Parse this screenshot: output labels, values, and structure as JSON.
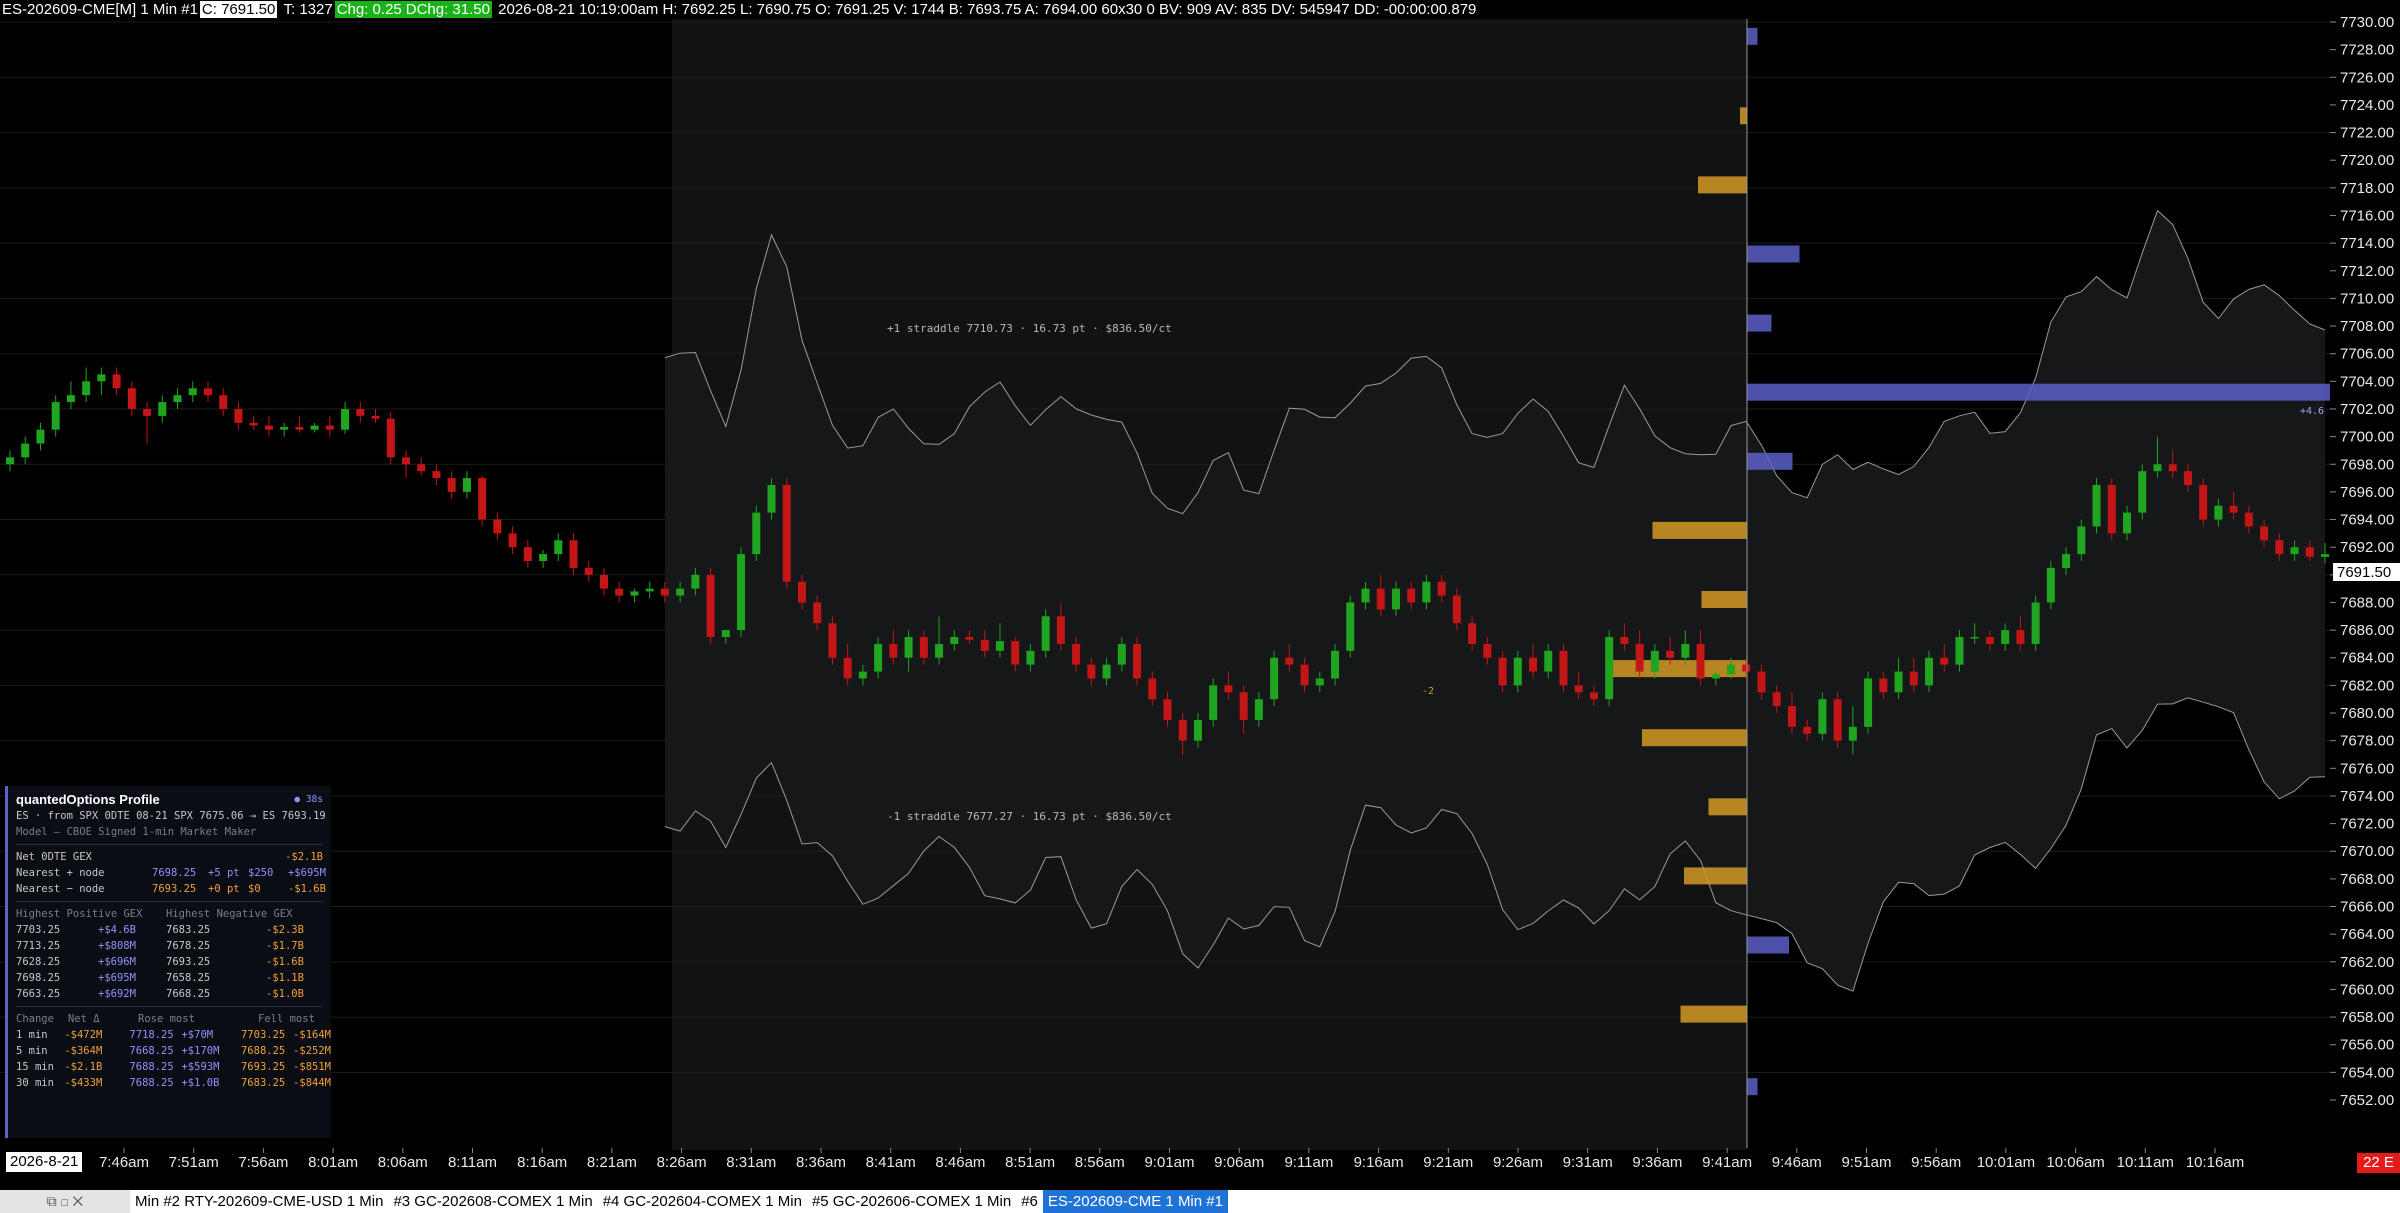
{
  "top_bar": {
    "symbol": "ES-202609-CME[M]  1 Min  #1",
    "close": "C: 7691.50",
    "ticks": "T: 1327",
    "change": "Chg: 0.25",
    "daily_change": "DChg: 31.50",
    "details": "2026-08-21 10:19:00am  H: 7692.25  L: 7690.75  O: 7691.25  V: 1744  B: 7693.75  A: 7694.00  60x30  0  BV: 909  AV: 835  DV: 545947  DD: -00:00:00.879"
  },
  "colors": {
    "up_candle": "#1fa51f",
    "down_candle": "#c41616",
    "positive_gex": "#5b5fc7",
    "negative_gex": "#d39a25",
    "background": "#000000",
    "last_price_box": "#ffffff"
  },
  "price_axis": {
    "labels": [
      "7730.00",
      "7728.00",
      "7726.00",
      "7724.00",
      "7722.00",
      "7720.00",
      "7718.00",
      "7716.00",
      "7714.00",
      "7712.00",
      "7710.00",
      "7708.00",
      "7706.00",
      "7704.00",
      "7702.00",
      "7700.00",
      "7698.00",
      "7696.00",
      "7694.00",
      "7692.00",
      "7690.00",
      "7688.00",
      "7686.00",
      "7684.00",
      "7682.00",
      "7680.00",
      "7678.00",
      "7676.00",
      "7674.00",
      "7672.00",
      "7670.00",
      "7668.00",
      "7666.00",
      "7664.00",
      "7662.00",
      "7660.00",
      "7658.00",
      "7656.00",
      "7654.00",
      "7652.00"
    ],
    "last_price": "7691.50"
  },
  "time_axis": {
    "date": "2026-8-21",
    "labels": [
      "7:46am",
      "7:51am",
      "7:56am",
      "8:01am",
      "8:06am",
      "8:11am",
      "8:16am",
      "8:21am",
      "8:26am",
      "8:31am",
      "8:36am",
      "8:41am",
      "8:46am",
      "8:51am",
      "8:56am",
      "9:01am",
      "9:06am",
      "9:11am",
      "9:16am",
      "9:21am",
      "9:26am",
      "9:31am",
      "9:36am",
      "9:41am",
      "9:46am",
      "9:51am",
      "9:56am",
      "10:01am",
      "10:06am",
      "10:11am",
      "10:16am"
    ]
  },
  "bars_on_chart": "22 E",
  "annotations": {
    "upper_straddle": "+1 straddle 7710.73 · 16.73 pt · $836.50/ct",
    "lower_straddle": "-1 straddle 7677.27 · 16.73 pt · $836.50/ct",
    "gex_marker": "-2",
    "right_marker": "+4.6"
  },
  "chart_data": {
    "type": "candlestick",
    "ylim": [
      7651,
      7731
    ],
    "interval": "1 Min",
    "gex_levels": [
      {
        "price": 7729.0,
        "gex_billion": 0.3,
        "sign": "positive"
      },
      {
        "price": 7723.25,
        "gex_billion": 0.2,
        "sign": "negative"
      },
      {
        "price": 7718.25,
        "gex_billion": 1.4,
        "sign": "negative"
      },
      {
        "price": 7713.25,
        "gex_billion": 1.5,
        "sign": "positive"
      },
      {
        "price": 7708.25,
        "gex_billion": 0.7,
        "sign": "positive"
      },
      {
        "price": 7703.25,
        "gex_billion": 4.6,
        "sign": "positive"
      },
      {
        "price": 7698.25,
        "gex_billion": 1.3,
        "sign": "positive"
      },
      {
        "price": 7693.25,
        "gex_billion": 2.7,
        "sign": "negative"
      },
      {
        "price": 7688.25,
        "gex_billion": 1.3,
        "sign": "negative"
      },
      {
        "price": 7683.25,
        "gex_billion": 4.0,
        "sign": "negative"
      },
      {
        "price": 7678.25,
        "gex_billion": 3.0,
        "sign": "negative"
      },
      {
        "price": 7673.25,
        "gex_billion": 1.1,
        "sign": "negative"
      },
      {
        "price": 7668.25,
        "gex_billion": 1.8,
        "sign": "negative"
      },
      {
        "price": 7663.25,
        "gex_billion": 1.2,
        "sign": "positive"
      },
      {
        "price": 7658.25,
        "gex_billion": 1.9,
        "sign": "negative"
      },
      {
        "price": 7653.0,
        "gex_billion": 0.3,
        "sign": "positive"
      }
    ],
    "candles": [
      [
        7698,
        7699,
        7697.5,
        7698.5
      ],
      [
        7698.5,
        7700,
        7698,
        7699.5
      ],
      [
        7699.5,
        7701,
        7699,
        7700.5
      ],
      [
        7700.5,
        7703,
        7700,
        7702.5
      ],
      [
        7702.5,
        7704,
        7702,
        7703
      ],
      [
        7703,
        7705,
        7702.5,
        7704
      ],
      [
        7704,
        7705,
        7703,
        7704.5
      ],
      [
        7704.5,
        7705,
        7703,
        7703.5
      ],
      [
        7703.5,
        7704,
        7701.5,
        7702
      ],
      [
        7702,
        7702.5,
        7699.5,
        7701.5
      ],
      [
        7701.5,
        7703,
        7701,
        7702.5
      ],
      [
        7702.5,
        7703.5,
        7702,
        7703
      ],
      [
        7703,
        7704,
        7702.5,
        7703.5
      ],
      [
        7703.5,
        7704,
        7702.5,
        7703
      ],
      [
        7703,
        7703.5,
        7701.5,
        7702
      ],
      [
        7702,
        7702.5,
        7700.5,
        7701
      ],
      [
        7701,
        7701.5,
        7700.5,
        7700.8
      ],
      [
        7700.8,
        7701.5,
        7700,
        7700.5
      ],
      [
        7700.5,
        7701,
        7700,
        7700.7
      ],
      [
        7700.7,
        7701.5,
        7700.3,
        7700.5
      ],
      [
        7700.5,
        7701,
        7700.3,
        7700.8
      ],
      [
        7700.8,
        7701.5,
        7700,
        7700.5
      ],
      [
        7700.5,
        7702.5,
        7700.2,
        7702
      ],
      [
        7702,
        7702.5,
        7701,
        7701.5
      ],
      [
        7701.5,
        7702,
        7701,
        7701.3
      ],
      [
        7701.3,
        7701.8,
        7698,
        7698.5
      ],
      [
        7698.5,
        7699,
        7697,
        7698
      ],
      [
        7698,
        7698.5,
        7697.2,
        7697.5
      ],
      [
        7697.5,
        7698,
        7696.5,
        7697
      ],
      [
        7697,
        7697.5,
        7695.5,
        7696
      ],
      [
        7696,
        7697.5,
        7695.5,
        7697
      ],
      [
        7697,
        7697.2,
        7693.5,
        7694
      ],
      [
        7694,
        7694.5,
        7692.5,
        7693
      ],
      [
        7693,
        7693.5,
        7691.5,
        7692
      ],
      [
        7692,
        7692.5,
        7690.5,
        7691
      ],
      [
        7691,
        7691.8,
        7690.5,
        7691.5
      ],
      [
        7691.5,
        7693,
        7691,
        7692.5
      ],
      [
        7692.5,
        7693,
        7690,
        7690.5
      ],
      [
        7690.5,
        7691,
        7689.5,
        7690
      ],
      [
        7690,
        7690.5,
        7688.5,
        7689
      ],
      [
        7689,
        7689.5,
        7688,
        7688.5
      ],
      [
        7688.5,
        7689,
        7688,
        7688.8
      ],
      [
        7688.8,
        7689.5,
        7688.3,
        7689
      ],
      [
        7689,
        7689.5,
        7688,
        7688.5
      ],
      [
        7688.5,
        7689.5,
        7688,
        7689
      ],
      [
        7689,
        7690.5,
        7688.5,
        7690
      ],
      [
        7690,
        7690.5,
        7685,
        7685.5
      ],
      [
        7685.5,
        7686,
        7685,
        7686
      ],
      [
        7686,
        7692,
        7685.5,
        7691.5
      ],
      [
        7691.5,
        7695,
        7691,
        7694.5
      ],
      [
        7694.5,
        7697,
        7694,
        7696.5
      ],
      [
        7696.5,
        7697,
        7689,
        7689.5
      ],
      [
        7689.5,
        7690,
        7687.5,
        7688
      ],
      [
        7688,
        7688.5,
        7686,
        7686.5
      ],
      [
        7686.5,
        7687,
        7683.5,
        7684
      ],
      [
        7684,
        7685,
        7682,
        7682.5
      ],
      [
        7682.5,
        7683.5,
        7682,
        7683
      ],
      [
        7683,
        7685.5,
        7682.5,
        7685
      ],
      [
        7685,
        7686,
        7683.5,
        7684
      ],
      [
        7684,
        7686,
        7683,
        7685.5
      ],
      [
        7685.5,
        7686,
        7683.5,
        7684
      ],
      [
        7684,
        7687,
        7683.5,
        7685
      ],
      [
        7685,
        7686,
        7684.5,
        7685.5
      ],
      [
        7685.5,
        7686,
        7685,
        7685.3
      ],
      [
        7685.3,
        7686,
        7684,
        7684.5
      ],
      [
        7684.5,
        7686.5,
        7684,
        7685.2
      ],
      [
        7685.2,
        7685.5,
        7683,
        7683.5
      ],
      [
        7683.5,
        7685,
        7683,
        7684.5
      ],
      [
        7684.5,
        7687.5,
        7684,
        7687
      ],
      [
        7687,
        7688,
        7684.5,
        7685
      ],
      [
        7685,
        7685.5,
        7683,
        7683.5
      ],
      [
        7683.5,
        7684,
        7682,
        7682.5
      ],
      [
        7682.5,
        7684,
        7682,
        7683.5
      ],
      [
        7683.5,
        7685.5,
        7683,
        7685
      ],
      [
        7685,
        7685.5,
        7682,
        7682.5
      ],
      [
        7682.5,
        7683,
        7680.5,
        7681
      ],
      [
        7681,
        7681.5,
        7679,
        7679.5
      ],
      [
        7679.5,
        7680,
        7677,
        7678
      ],
      [
        7678,
        7680,
        7677.5,
        7679.5
      ],
      [
        7679.5,
        7682.5,
        7679,
        7682
      ],
      [
        7682,
        7683,
        7681,
        7681.5
      ],
      [
        7681.5,
        7682,
        7678.5,
        7679.5
      ],
      [
        7679.5,
        7681.5,
        7679,
        7681
      ],
      [
        7681,
        7684.5,
        7680.5,
        7684
      ],
      [
        7684,
        7685,
        7683,
        7683.5
      ],
      [
        7683.5,
        7684,
        7681.5,
        7682
      ],
      [
        7682,
        7683,
        7681.5,
        7682.5
      ],
      [
        7682.5,
        7685,
        7682,
        7684.5
      ],
      [
        7684.5,
        7688.5,
        7684,
        7688
      ],
      [
        7688,
        7689.5,
        7687.5,
        7689
      ],
      [
        7689,
        7690,
        7687,
        7687.5
      ],
      [
        7687.5,
        7689.5,
        7687,
        7689
      ],
      [
        7689,
        7689.5,
        7687.5,
        7688
      ],
      [
        7688,
        7690,
        7687.5,
        7689.5
      ],
      [
        7689.5,
        7690,
        7688,
        7688.5
      ],
      [
        7688.5,
        7689,
        7686,
        7686.5
      ],
      [
        7686.5,
        7687,
        7684.5,
        7685
      ],
      [
        7685,
        7685.5,
        7683.5,
        7684
      ],
      [
        7684,
        7684.5,
        7681.5,
        7682
      ],
      [
        7682,
        7684.5,
        7681.5,
        7684
      ],
      [
        7684,
        7685,
        7682.5,
        7683
      ],
      [
        7683,
        7685,
        7682.5,
        7684.5
      ],
      [
        7684.5,
        7685,
        7681.5,
        7682
      ],
      [
        7682,
        7683,
        7681,
        7681.5
      ],
      [
        7681.5,
        7682,
        7680.5,
        7681
      ],
      [
        7681,
        7686,
        7680.5,
        7685.5
      ],
      [
        7685.5,
        7686.5,
        7684.5,
        7685
      ],
      [
        7685,
        7686,
        7682.5,
        7683
      ],
      [
        7683,
        7685,
        7682.5,
        7684.5
      ],
      [
        7684.5,
        7685.5,
        7683.5,
        7684
      ],
      [
        7684,
        7686,
        7683.5,
        7685
      ],
      [
        7685,
        7686,
        7682,
        7682.5
      ],
      [
        7682.5,
        7683,
        7682,
        7682.8
      ],
      [
        7682.8,
        7684,
        7682.5,
        7683.5
      ],
      [
        7683.5,
        7684,
        7682.5,
        7683
      ],
      [
        7683,
        7683.5,
        7681,
        7681.5
      ],
      [
        7681.5,
        7682,
        7680,
        7680.5
      ],
      [
        7680.5,
        7681.5,
        7678.5,
        7679
      ],
      [
        7679,
        7679.5,
        7678,
        7678.5
      ],
      [
        7678.5,
        7681.5,
        7678,
        7681
      ],
      [
        7681,
        7681.5,
        7677.5,
        7678
      ],
      [
        7678,
        7680.5,
        7677,
        7679
      ],
      [
        7679,
        7683,
        7678.5,
        7682.5
      ],
      [
        7682.5,
        7683,
        7681,
        7681.5
      ],
      [
        7681.5,
        7684,
        7681,
        7683
      ],
      [
        7683,
        7684,
        7681.5,
        7682
      ],
      [
        7682,
        7684.5,
        7681.5,
        7684
      ],
      [
        7684,
        7685,
        7683,
        7683.5
      ],
      [
        7683.5,
        7686,
        7683,
        7685.5
      ],
      [
        7685.5,
        7686.5,
        7685,
        7685.5
      ],
      [
        7685.5,
        7686,
        7684.5,
        7685
      ],
      [
        7685,
        7686.5,
        7684.5,
        7686
      ],
      [
        7686,
        7687,
        7684.5,
        7685
      ],
      [
        7685,
        7688.5,
        7684.5,
        7688
      ],
      [
        7688,
        7691,
        7687.5,
        7690.5
      ],
      [
        7690.5,
        7692,
        7690,
        7691.5
      ],
      [
        7691.5,
        7694,
        7691,
        7693.5
      ],
      [
        7693.5,
        7697,
        7693,
        7696.5
      ],
      [
        7696.5,
        7697,
        7692.5,
        7693
      ],
      [
        7693,
        7695,
        7692.5,
        7694.5
      ],
      [
        7694.5,
        7698,
        7694,
        7697.5
      ],
      [
        7697.5,
        7700,
        7697,
        7698
      ],
      [
        7698,
        7699,
        7697,
        7697.5
      ],
      [
        7697.5,
        7698,
        7696,
        7696.5
      ],
      [
        7696.5,
        7697,
        7693.5,
        7694
      ],
      [
        7694,
        7695.5,
        7693.5,
        7695
      ],
      [
        7695,
        7696,
        7694,
        7694.5
      ],
      [
        7694.5,
        7695,
        7693,
        7693.5
      ],
      [
        7693.5,
        7694,
        7692,
        7692.5
      ],
      [
        7692.5,
        7693,
        7691,
        7691.5
      ],
      [
        7691.5,
        7692.5,
        7691,
        7692
      ],
      [
        7692,
        7692.5,
        7691,
        7691.3
      ],
      [
        7691.3,
        7692.3,
        7690.8,
        7691.5
      ]
    ]
  },
  "gex_panel": {
    "title": "quantedOptions Profile",
    "age": "● 38s",
    "source": "ES · from SPX 0DTE 08-21  SPX 7675.06 → ES 7693.19",
    "model": "Model — CBOE Signed 1-min Market Maker",
    "net_label": "Net 0DTE GEX",
    "net_value": "-$2.1B",
    "nearest_pos": {
      "label": "Nearest + node",
      "price": "7698.25",
      "dist": "+5 pt",
      "cost": "$250",
      "gex": "+$695M"
    },
    "nearest_neg": {
      "label": "Nearest − node",
      "price": "7693.25",
      "dist": "+0 pt",
      "cost": "$0",
      "gex": "-$1.6B"
    },
    "highest_pos_header": "Highest Positive GEX",
    "highest_neg_header": "Highest Negative GEX",
    "highest_rows": [
      {
        "pos_price": "7703.25",
        "pos_val": "+$4.6B",
        "neg_price": "7683.25",
        "neg_val": "-$2.3B"
      },
      {
        "pos_price": "7713.25",
        "pos_val": "+$808M",
        "neg_price": "7678.25",
        "neg_val": "-$1.7B"
      },
      {
        "pos_price": "7628.25",
        "pos_val": "+$696M",
        "neg_price": "7693.25",
        "neg_val": "-$1.6B"
      },
      {
        "pos_price": "7698.25",
        "pos_val": "+$695M",
        "neg_price": "7658.25",
        "neg_val": "-$1.1B"
      },
      {
        "pos_price": "7663.25",
        "pos_val": "+$692M",
        "neg_price": "7668.25",
        "neg_val": "-$1.0B"
      }
    ],
    "change_headers": {
      "change": "Change",
      "net": "Net Δ",
      "rose": "Rose most",
      "fell": "Fell most"
    },
    "change_rows": [
      {
        "period": "1 min",
        "net": "-$472M",
        "rose_price": "7718.25",
        "rose_val": "+$70M",
        "fell_price": "7703.25",
        "fell_val": "-$164M"
      },
      {
        "period": "5 min",
        "net": "-$364M",
        "rose_price": "7668.25",
        "rose_val": "+$170M",
        "fell_price": "7688.25",
        "fell_val": "-$252M"
      },
      {
        "period": "15 min",
        "net": "-$2.1B",
        "rose_price": "7688.25",
        "rose_val": "+$593M",
        "fell_price": "7693.25",
        "fell_val": "-$851M"
      },
      {
        "period": "30 min",
        "net": "-$433M",
        "rose_price": "7688.25",
        "rose_val": "+$1.0B",
        "fell_price": "7683.25",
        "fell_val": "-$844M"
      }
    ]
  },
  "tab_bar": {
    "win_controls": "⧉  ◻  ✕",
    "tabs": [
      {
        "label": "Min  #2 RTY-202609-CME-USD  1 Min",
        "active": false
      },
      {
        "label": "#3 GC-202608-COMEX  1 Min",
        "active": false
      },
      {
        "label": "#4 GC-202604-COMEX  1 Min",
        "active": false
      },
      {
        "label": "#5 GC-202606-COMEX  1 Min",
        "active": false
      },
      {
        "label": "#6",
        "active": false
      },
      {
        "label": "ES-202609-CME  1 Min  #1",
        "active": true
      }
    ]
  }
}
